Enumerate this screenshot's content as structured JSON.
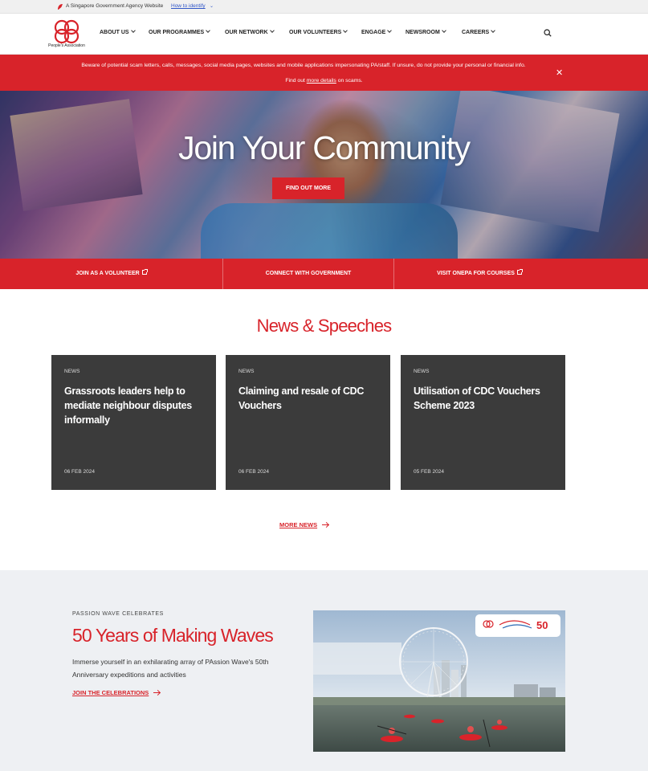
{
  "masthead": {
    "text": "A Singapore Government Agency Website",
    "identify_link": "How to identify"
  },
  "logo": {
    "caption": "People's Association"
  },
  "nav": {
    "items": [
      {
        "label": "ABOUT US"
      },
      {
        "label": "OUR PROGRAMMES"
      },
      {
        "label": "OUR NETWORK"
      },
      {
        "label": "OUR VOLUNTEERS"
      },
      {
        "label": "ENGAGE"
      },
      {
        "label": "NEWSROOM"
      },
      {
        "label": "CAREERS"
      }
    ],
    "search_icon": "search-icon"
  },
  "scam_notice": {
    "message": "Beware of potential scam letters, calls, messages, social media pages, websites and mobile applications impersonating PA/staff. If unsure, do not provide your personal or financial info.",
    "find_out_prefix": "Find out",
    "find_out_link": "more details",
    "find_out_suffix": "on scams.",
    "close_icon": "close-icon",
    "close_glyph": "✕"
  },
  "hero": {
    "title": "Join Your Community",
    "button_label": "FIND OUT MORE"
  },
  "quick_links": [
    {
      "label": "JOIN AS A VOLUNTEER",
      "external": true
    },
    {
      "label": "CONNECT WITH GOVERNMENT",
      "external": false
    },
    {
      "label": "VISIT ONEPA FOR COURSES",
      "external": true
    }
  ],
  "news": {
    "title": "News & Speeches",
    "cards": [
      {
        "tag": "NEWS",
        "headline": "Grassroots leaders help to mediate neighbour disputes informally",
        "date": "06 FEB 2024"
      },
      {
        "tag": "NEWS",
        "headline": "Claiming and resale of CDC Vouchers",
        "date": "06 FEB 2024"
      },
      {
        "tag": "NEWS",
        "headline": "Utilisation of CDC Vouchers Scheme 2023",
        "date": "05 FEB 2024"
      }
    ],
    "more_label": "MORE NEWS"
  },
  "passion_wave": {
    "eyebrow": "PASSION WAVE CELEBRATES",
    "title": "50 Years of Making Waves",
    "description": "Immerse yourself in an exhilarating array of PAssion Wave's 50th Anniversary expeditions and activities",
    "cta_label": "JOIN THE CELEBRATIONS",
    "photo_badge_text": "50"
  },
  "colors": {
    "brand_red": "#d8232a",
    "card_bg": "#3b3b3b",
    "section_bg": "#eef0f3"
  }
}
